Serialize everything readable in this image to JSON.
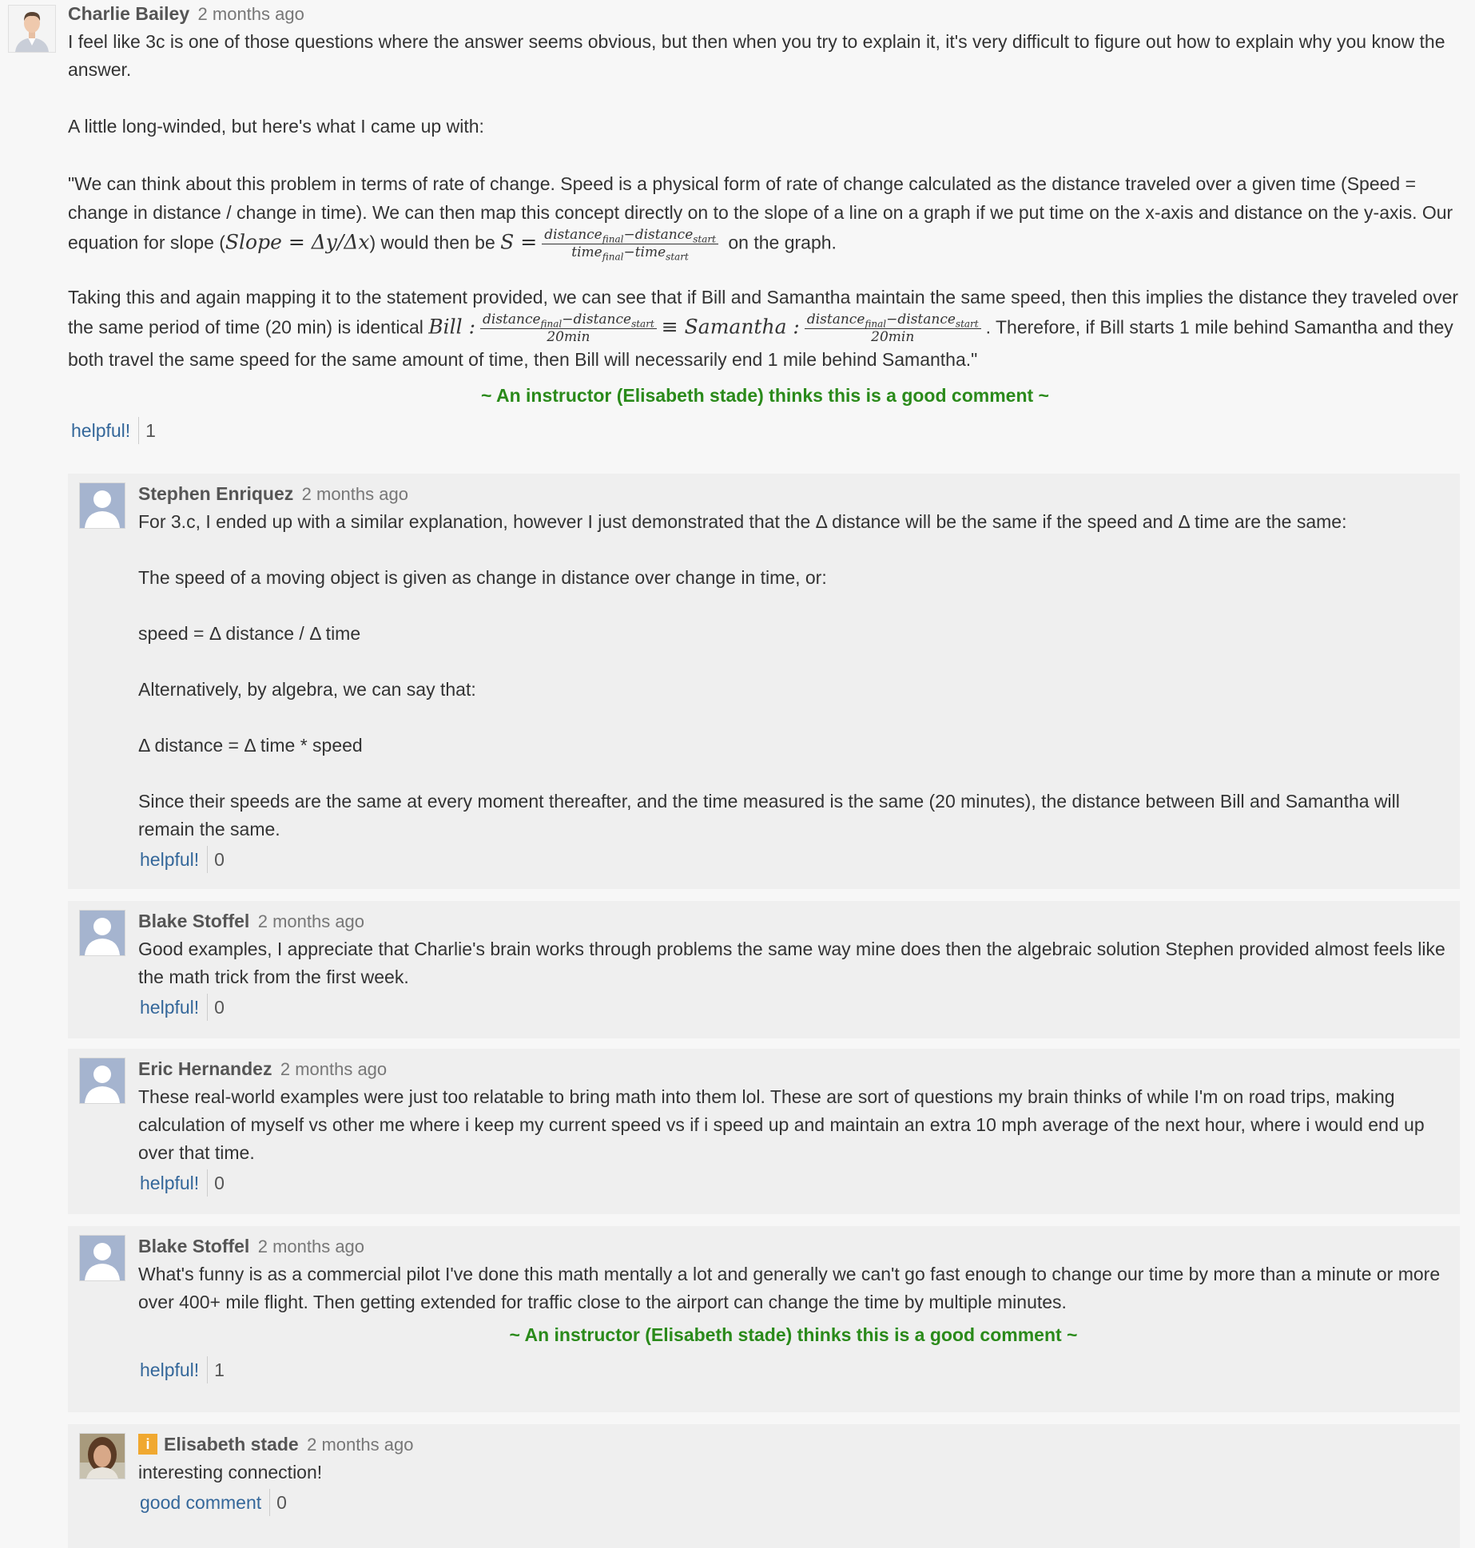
{
  "main": {
    "author": "Charlie Bailey",
    "time": "2 months ago",
    "p1": "I feel like 3c is one of those questions where the answer seems obvious, but then when you try to explain it, it's very difficult to figure out how to explain why you know the answer.",
    "p2": "A little long-winded, but here's what I came up with:",
    "p3a": "\"We can think about this problem in terms of rate of change. Speed is a physical form of rate of change calculated as the distance traveled over a given time (Speed = change in distance / change in time). We can then map this concept directly on to the slope of a line on a graph if we put time on the x-axis and distance on the y-axis. Our equation for slope (",
    "p3_slope": "Slope = Δy/Δx",
    "p3b": ") would then be ",
    "p3_s": "S =",
    "frac1_num": "distance final − distance start",
    "frac1_num_a": "distance",
    "frac1_num_a_sub": "final",
    "frac1_num_b": "−distance",
    "frac1_num_b_sub": "start",
    "frac1_den_a": "time",
    "frac1_den_a_sub": "final",
    "frac1_den_b": "−time",
    "frac1_den_b_sub": "start",
    "p3c": " on the graph.",
    "p4a": "Taking this and again mapping it to the statement provided, we can see that if Bill and Samantha maintain the same speed, then this implies the distance they traveled over the same period of time (20 min) is identical ",
    "p4_bill": "Bill :",
    "p4_equiv": "≡ Samantha :",
    "frac2_den": "20min",
    "p4b": ". Therefore, if Bill starts 1 mile behind Samantha and they both travel the same speed for the same amount of time, then Bill will necessarily end 1 mile behind Samantha.\"",
    "good_comment": "~ An instructor (Elisabeth stade) thinks this is a good comment ~",
    "helpful_label": "helpful!",
    "helpful_count": "1"
  },
  "replies": [
    {
      "author": "Stephen Enriquez",
      "time": "2 months ago",
      "paragraphs": [
        "For 3.c, I ended up with a similar explanation, however I just demonstrated that the Δ distance will be the same if the speed and Δ time are the same:",
        "The speed of a moving object is given as change in distance over change in time, or:",
        "speed = Δ distance / Δ time",
        "Alternatively, by algebra, we can say that:",
        "Δ distance = Δ time * speed",
        "Since their speeds are the same at every moment thereafter, and the time measured is the same (20 minutes), the distance between Bill and Samantha will remain the same."
      ],
      "helpful_label": "helpful!",
      "helpful_count": "0"
    },
    {
      "author": "Blake Stoffel",
      "time": "2 months ago",
      "paragraphs": [
        "Good examples, I appreciate that Charlie's brain works through problems the same way mine does then the algebraic solution Stephen provided almost feels like the math trick from the first week."
      ],
      "helpful_label": "helpful!",
      "helpful_count": "0"
    },
    {
      "author": "Eric Hernandez",
      "time": "2 months ago",
      "paragraphs": [
        "These real-world examples were just too relatable to bring math into them lol. These are sort of questions my brain thinks of while I'm on road trips, making calculation of myself vs other me where i keep my current speed vs if i speed up and maintain an extra 10 mph average of the next hour, where i would end up over that time."
      ],
      "helpful_label": "helpful!",
      "helpful_count": "0"
    },
    {
      "author": "Blake Stoffel",
      "time": "2 months ago",
      "paragraphs": [
        "What's funny is as a commercial pilot I've done this math mentally a lot and generally we can't go fast enough to change our time by more than a minute or more over 400+ mile flight. Then getting extended for traffic close to the airport can change the time by multiple minutes."
      ],
      "good_comment": "~ An instructor (Elisabeth stade) thinks this is a good comment ~",
      "helpful_label": "helpful!",
      "helpful_count": "1"
    },
    {
      "author": "Elisabeth stade",
      "badge": "i",
      "time": "2 months ago",
      "paragraphs": [
        "interesting connection!"
      ],
      "helpful_label": "good comment",
      "helpful_count": "0"
    }
  ],
  "colors": {
    "link": "#34679a",
    "good_comment": "#2a8a1a",
    "instructor_badge": "#f0a830"
  }
}
